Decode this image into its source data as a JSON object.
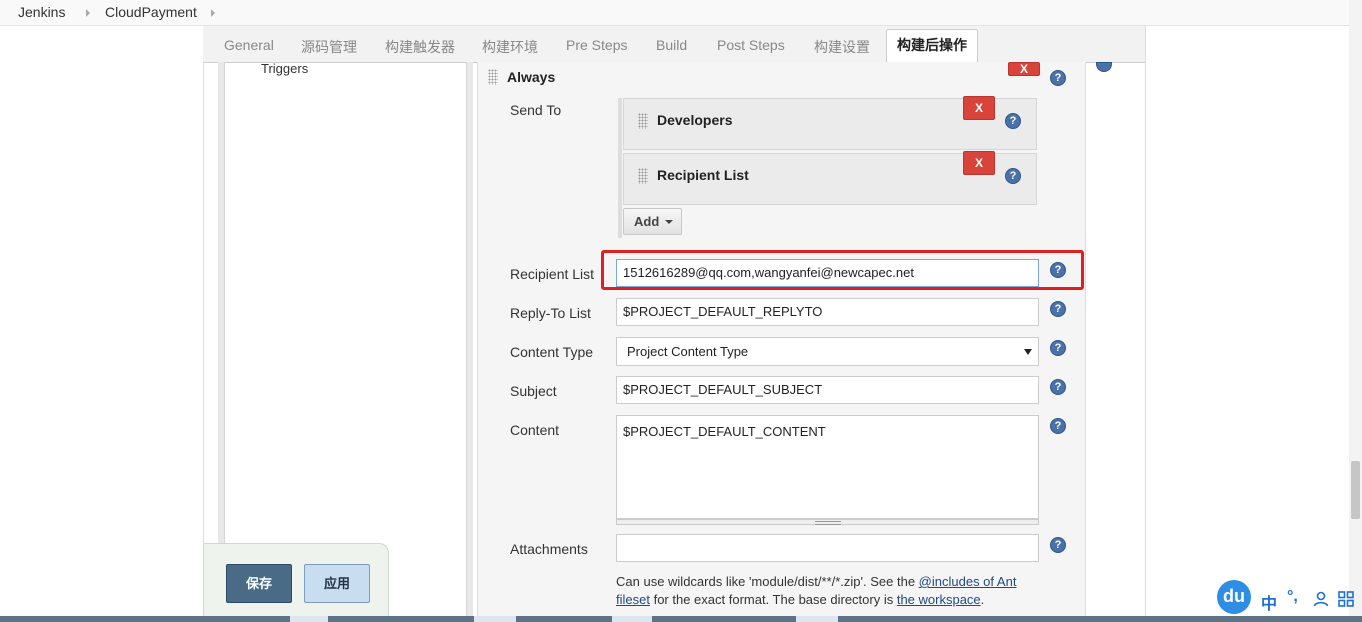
{
  "breadcrumb": {
    "items": [
      "Jenkins",
      "CloudPayment"
    ]
  },
  "tabs": [
    "General",
    "源码管理",
    "构建触发器",
    "构建环境",
    "Pre Steps",
    "Build",
    "Post Steps",
    "构建设置",
    "构建后操作"
  ],
  "sidebar": {
    "triggers_label": "Triggers"
  },
  "trigger": {
    "title": "Always",
    "delete_label": "X",
    "send_to_label": "Send To",
    "recipients": [
      {
        "name": "Developers",
        "delete_label": "X"
      },
      {
        "name": "Recipient List",
        "delete_label": "X"
      }
    ],
    "add_label": "Add"
  },
  "fields": {
    "recipient_list": {
      "label": "Recipient List",
      "value": "1512616289@qq.com,wangyanfei@newcapec.net"
    },
    "reply_to": {
      "label": "Reply-To List",
      "value": "$PROJECT_DEFAULT_REPLYTO"
    },
    "content_type": {
      "label": "Content Type",
      "value": "Project Content Type"
    },
    "subject": {
      "label": "Subject",
      "value": "$PROJECT_DEFAULT_SUBJECT"
    },
    "content": {
      "label": "Content",
      "value": "$PROJECT_DEFAULT_CONTENT"
    },
    "attachments": {
      "label": "Attachments",
      "value": ""
    }
  },
  "help_text": {
    "part1": "Can use wildcards like 'module/dist/**/*.zip'. See the ",
    "link1": "@includes of Ant fileset",
    "part2": " for the exact format. The base directory is ",
    "link2": "the workspace",
    "part3": "."
  },
  "help_icon_glyph": "?",
  "actions": {
    "save_label": "保存",
    "apply_label": "应用"
  },
  "ime": {
    "logo": "du",
    "zh": "中",
    "punct": "°,"
  },
  "colors": {
    "highlight": "#e02020",
    "delete": "#d9443a",
    "save": "#4a6b86",
    "help": "#4a72a8"
  }
}
